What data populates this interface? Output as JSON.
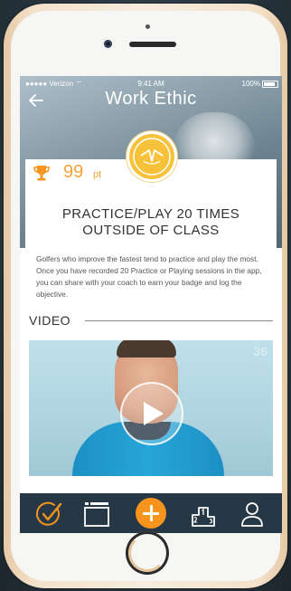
{
  "status": {
    "carrier": "●●●●● Verizon ⌔",
    "time": "9:41 AM",
    "battery": "100%"
  },
  "header": {
    "title": "Work Ethic"
  },
  "badge": {
    "points": "99",
    "unit": "pt"
  },
  "card": {
    "title_line1": "PRACTICE/PLAY 20 TIMES",
    "title_line2": "OUTSIDE OF CLASS",
    "description": "Golfers who improve the fastest tend to practice and play the most.  Once you have recorded 20 Practice or Playing sessions in the app, you can share with your coach to earn your badge and log the objective."
  },
  "video": {
    "section_label": "VIDEO",
    "watermark": "36"
  },
  "colors": {
    "accent": "#f7941d",
    "badge_gold": "#f7c23a",
    "tabbar": "#263846"
  },
  "tabs": [
    {
      "icon": "checkmark-circle-icon"
    },
    {
      "icon": "calendar-icon"
    },
    {
      "icon": "add-icon"
    },
    {
      "icon": "leaderboard-icon"
    },
    {
      "icon": "profile-icon"
    }
  ]
}
